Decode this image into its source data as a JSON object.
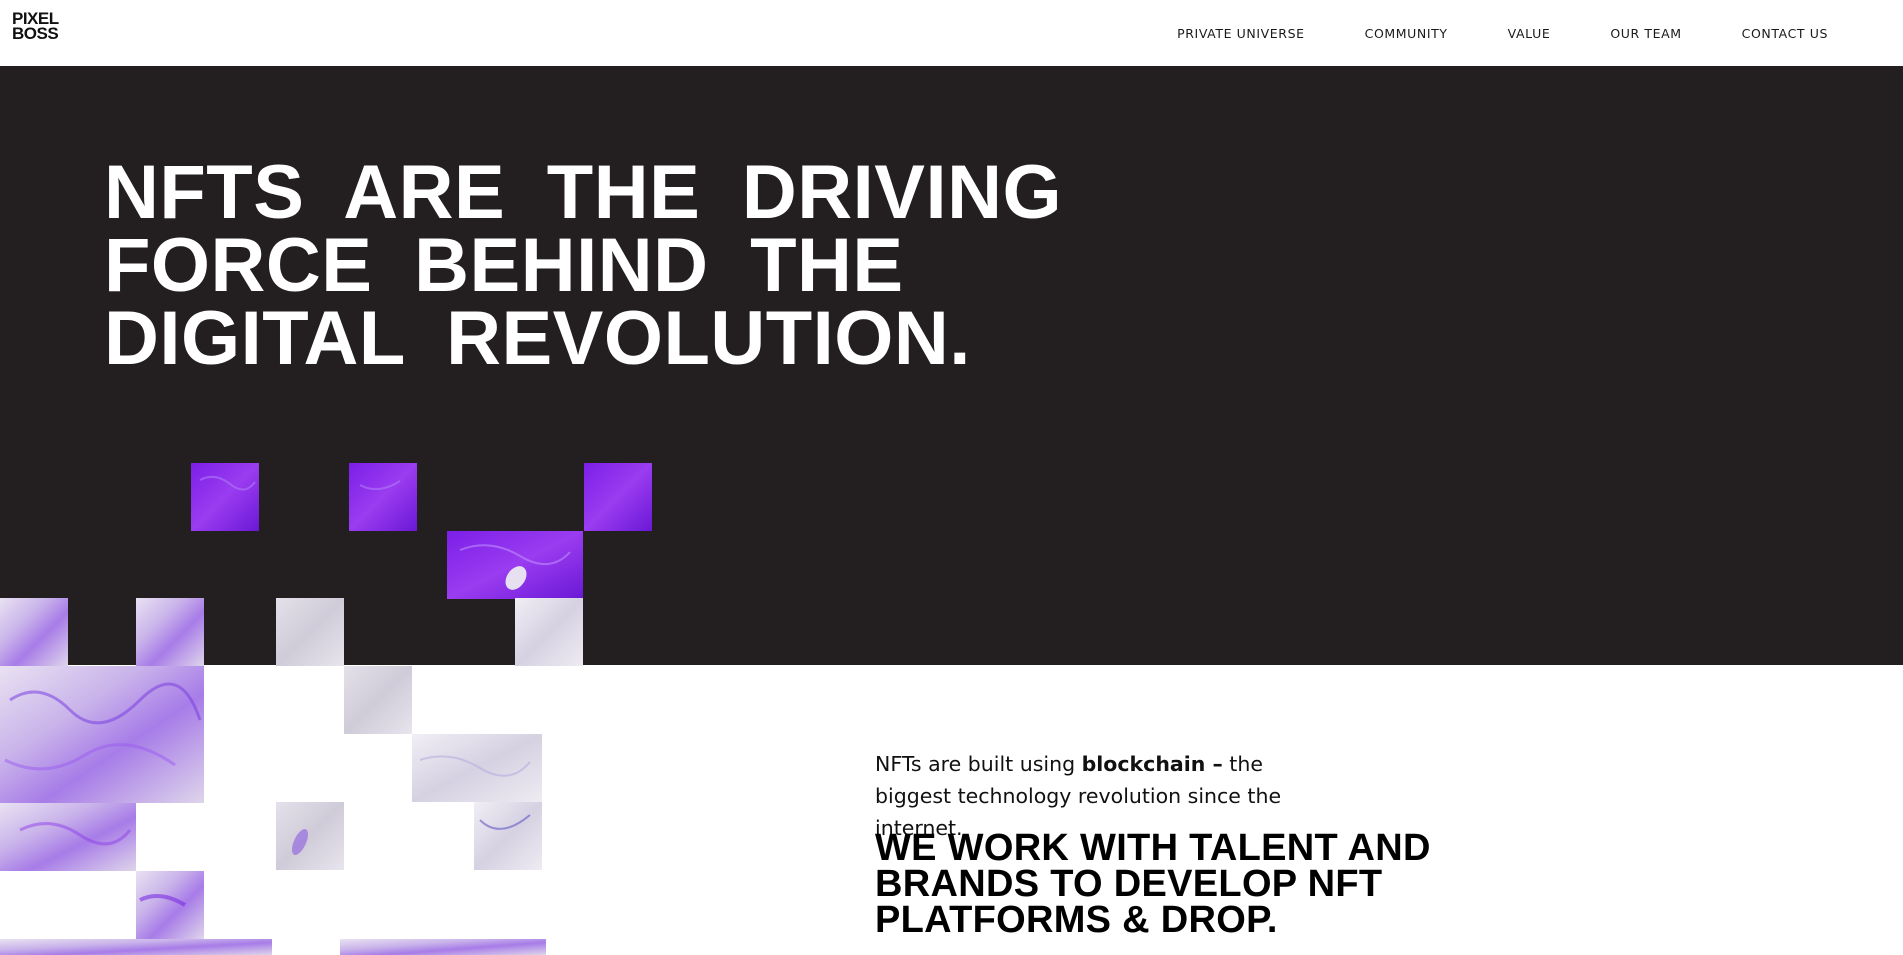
{
  "header": {
    "logo_line1": "PIXEL",
    "logo_line2": "BOSS",
    "nav": [
      {
        "label": "PRIVATE UNIVERSE"
      },
      {
        "label": "COMMUNITY"
      },
      {
        "label": "VALUE"
      },
      {
        "label": "OUR TEAM"
      },
      {
        "label": "CONTACT US"
      }
    ]
  },
  "hero": {
    "title": "NFTS ARE THE DRIVING FORCE BEHIND THE DIGITAL REVOLUTION.",
    "background_color": "#231f20"
  },
  "content": {
    "intro_before": "NFTs are built using ",
    "intro_bold": "blockchain –",
    "intro_after": " the biggest technology revolution since the internet.",
    "tagline": "WE WORK WITH TALENT AND BRANDS TO DEVELOP NFT PLATFORMS & DROP."
  },
  "colors": {
    "accent_purple": "#8a2be2",
    "text_dark": "#111111"
  }
}
